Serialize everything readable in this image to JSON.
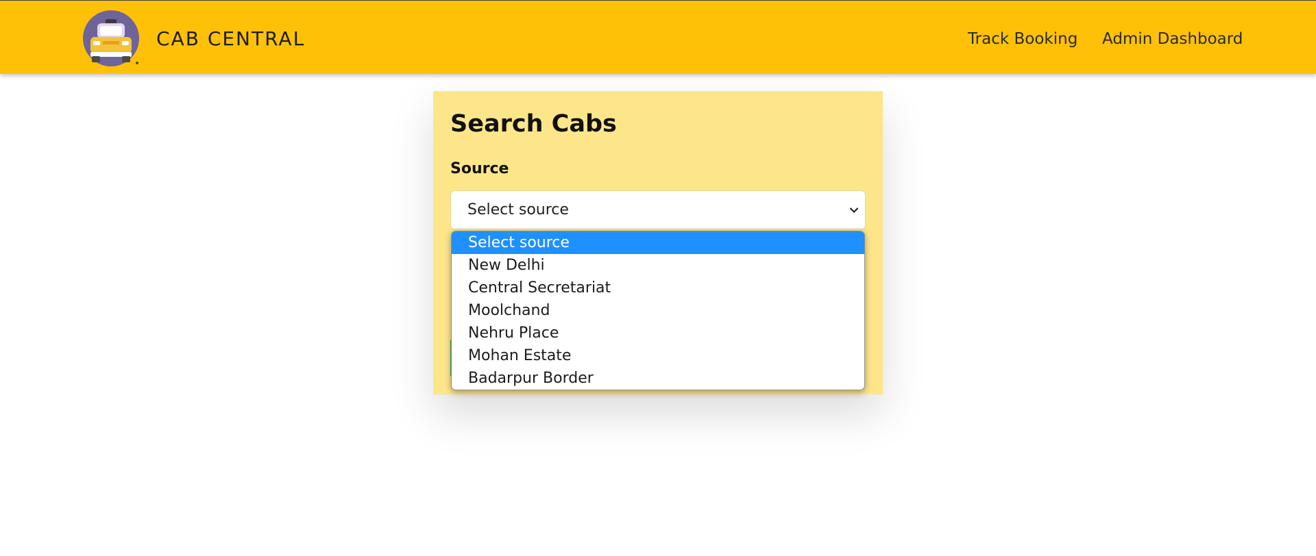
{
  "brand": {
    "name": "CAB CENTRAL",
    "logo_icon": "taxi-logo-icon"
  },
  "nav": {
    "links": [
      {
        "label": "Track Booking"
      },
      {
        "label": "Admin Dashboard"
      }
    ]
  },
  "search": {
    "title": "Search Cabs",
    "source_label": "Source",
    "source_value": "Select source",
    "chevron_icon": "chevron-down-icon",
    "options": [
      "Select source",
      "New Delhi",
      "Central Secretariat",
      "Moolchand",
      "Nehru Place",
      "Mohan Estate",
      "Badarpur Border"
    ],
    "selected_index": 0
  },
  "colors": {
    "navbar": "#ffc107",
    "card": "#fde68a",
    "option_highlight": "#1e90ff",
    "submit_button": "#3a9a52"
  }
}
